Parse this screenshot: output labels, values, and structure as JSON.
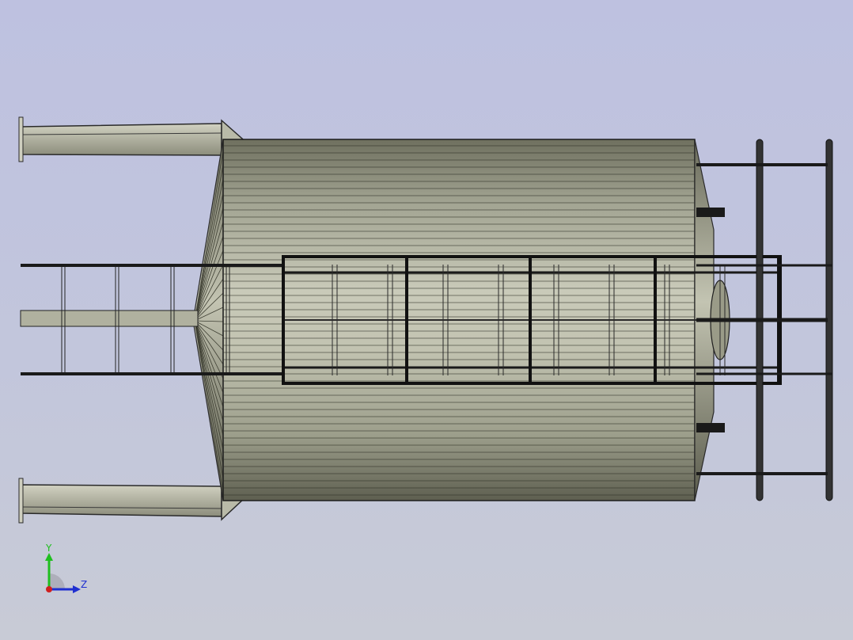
{
  "viewport": {
    "background_top": "#bec1e0",
    "background_bottom": "#c8cbd6"
  },
  "model": {
    "shell_color": "#8f917f",
    "frame_color": "#1a1a1a",
    "support_color": "#b8b8a6"
  },
  "triad": {
    "y_label": "Y",
    "z_label": "Z",
    "y_color": "#1fbf1f",
    "z_color": "#1f2fd0",
    "origin_color": "#d01f1f"
  }
}
